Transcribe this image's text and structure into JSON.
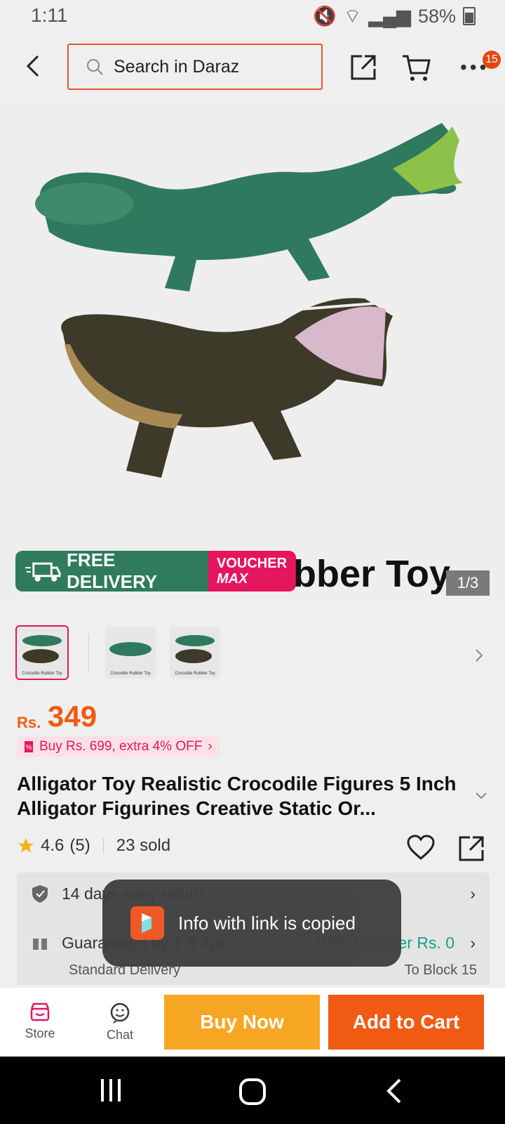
{
  "status_bar": {
    "time": "1:11",
    "battery": "58%"
  },
  "header": {
    "search_placeholder": "Search in Daraz",
    "cart_badge": "15"
  },
  "gallery": {
    "promo_banner": {
      "free_delivery": "FREE DELIVERY",
      "voucher_line1": "VOUCHER",
      "voucher_line2": "MAX",
      "free_tag": "FREE"
    },
    "caption_partial": "bber Toy",
    "counter": "1/3",
    "thumb_label": "Crocodile Rubber Toy"
  },
  "product": {
    "price_currency": "Rs.",
    "price": "349",
    "promo": "Buy Rs. 699, extra 4% OFF",
    "title": "Alligator Toy Realistic Crocodile Figures 5 Inch Alligator Figurines Creative Static Or...",
    "rating": "4.6",
    "reviews": "(5)",
    "sold": "23 sold"
  },
  "services": {
    "return": "14 days easy return",
    "delivery": "Guaranteed by 7-9 Apr",
    "voucher_text": "With Voucher Rs. 0",
    "delivery_type": "Standard Delivery",
    "destination": "To Block 15"
  },
  "toast": {
    "message": "Info with link is copied"
  },
  "bottom_bar": {
    "store": "Store",
    "chat": "Chat",
    "buy_now": "Buy Now",
    "add_to_cart": "Add to Cart"
  },
  "colors": {
    "accent": "#f05a13",
    "buy_now": "#f6a623",
    "pink": "#e5155e",
    "green": "#2f7b5b",
    "teal": "#13a28b"
  }
}
